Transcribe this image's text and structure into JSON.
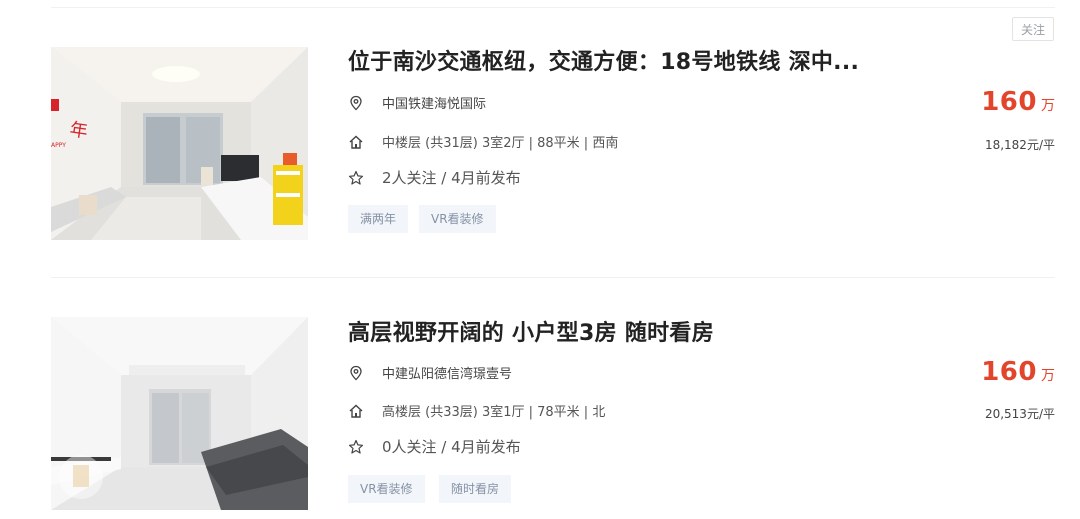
{
  "follow_button_label": "关注",
  "listings": [
    {
      "title": "位于南沙交通枢纽，交通方便：18号地铁线 深中...",
      "community": "中国铁建海悦国际",
      "house_info": "中楼层 (共31层) 3室2厅 | 88平米 | 西南",
      "follow_info": "2人关注 / 4月前发布",
      "tags": [
        "满两年",
        "VR看装修"
      ],
      "total_price": "160",
      "price_unit": "万",
      "unit_price": "18,182元/平"
    },
    {
      "title": "高层视野开阔的 小户型3房 随时看房",
      "community": "中建弘阳德信湾璟壹号",
      "house_info": "高楼层 (共33层) 3室1厅 | 78平米 | 北",
      "follow_info": "0人关注 / 4月前发布",
      "tags": [
        "VR看装修",
        "随时看房"
      ],
      "total_price": "160",
      "price_unit": "万",
      "unit_price": "20,513元/平"
    }
  ],
  "colors": {
    "price": "#e2452b",
    "tag_text": "#8592a6",
    "tag_bg": "#f2f5f9"
  }
}
